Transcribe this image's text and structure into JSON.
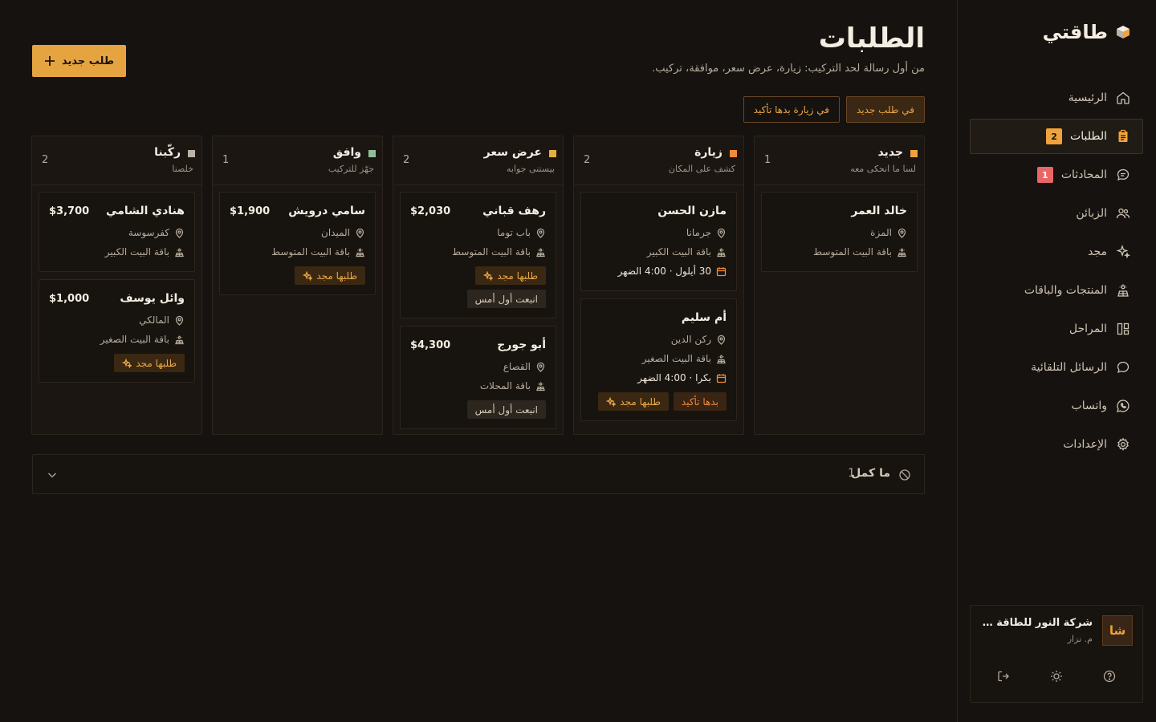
{
  "brand": {
    "name": "طاقتي",
    "icon": "cube-icon"
  },
  "nav": [
    {
      "label": "الرئيسية",
      "icon": "home-icon",
      "badge": ""
    },
    {
      "label": "الطلبات",
      "icon": "clipboard-icon",
      "badge": "2"
    },
    {
      "label": "المحادثات",
      "icon": "chat-icon",
      "badge": "1"
    },
    {
      "label": "الزبائن",
      "icon": "users-icon",
      "badge": ""
    },
    {
      "label": "مجد",
      "icon": "sparkles-icon",
      "badge": ""
    },
    {
      "label": "المنتجات والباقات",
      "icon": "solar-panel-icon",
      "badge": ""
    },
    {
      "label": "المراحل",
      "icon": "kanban-icon",
      "badge": ""
    },
    {
      "label": "الرسائل التلقائية",
      "icon": "message-icon",
      "badge": ""
    },
    {
      "label": "واتساب",
      "icon": "whatsapp-icon",
      "badge": ""
    },
    {
      "label": "الإعدادات",
      "icon": "gear-icon",
      "badge": ""
    }
  ],
  "account": {
    "avatar": "شا",
    "name": "شركة النور للطاقة الشمسية",
    "role": "م. نزار"
  },
  "header": {
    "title": "الطلبات",
    "subtitle": "من أول رسالة لحد التركيب: زيارة، عرض سعر، موافقة، تركيب.",
    "new_order_label": "طلب جديد"
  },
  "filters": [
    {
      "label": "في طلب جديد",
      "active": true
    },
    {
      "label": "في زيارة بدها تأكيد",
      "active": false
    }
  ],
  "columns": [
    {
      "title": "جديد",
      "desc": "لسا ما انحكى معه",
      "count": "1",
      "color": "#f0a23c",
      "cards": [
        {
          "name": "خالد العمر",
          "price": "",
          "location": "المزة",
          "package": "باقة البيت المتوسط",
          "date": "",
          "tags": []
        }
      ]
    },
    {
      "title": "زيارة",
      "desc": "كشف على المكان",
      "count": "2",
      "color": "#f08b3c",
      "cards": [
        {
          "name": "مازن الحسن",
          "price": "",
          "location": "جرمانا",
          "package": "باقة البيت الكبير",
          "date": "30 أيلول · 4:00 الضهر",
          "tags": []
        },
        {
          "name": "أم سليم",
          "price": "",
          "location": "ركن الدين",
          "package": "باقة البيت الصغير",
          "date": "بكرا · 4:00 الضهر",
          "tags": [
            {
              "label": "بدها تأكيد",
              "kind": "confirm"
            },
            {
              "label": "طلبها مجد",
              "kind": "majd"
            }
          ]
        }
      ]
    },
    {
      "title": "عرض سعر",
      "desc": "بيستنى جوابه",
      "count": "2",
      "color": "#e5b03f",
      "cards": [
        {
          "name": "رهف قباني",
          "price": "$2,030",
          "location": "باب توما",
          "package": "باقة البيت المتوسط",
          "date": "",
          "tags": [
            {
              "label": "طلبها مجد",
              "kind": "majd"
            },
            {
              "label": "انبعت أول أمس",
              "kind": "followup"
            }
          ]
        },
        {
          "name": "أبو جورج",
          "price": "$4,300",
          "location": "القصاع",
          "package": "باقة المحلات",
          "date": "",
          "tags": [
            {
              "label": "انبعت أول أمس",
              "kind": "followup"
            }
          ]
        }
      ]
    },
    {
      "title": "وافق",
      "desc": "جهّز للتركيب",
      "count": "1",
      "color": "#8fbf9a",
      "cards": [
        {
          "name": "سامي درويش",
          "price": "$1,900",
          "location": "الميدان",
          "package": "باقة البيت المتوسط",
          "date": "",
          "tags": [
            {
              "label": "طلبها مجد",
              "kind": "majd"
            }
          ]
        }
      ]
    },
    {
      "title": "ركّبنا",
      "desc": "خلصنا",
      "count": "2",
      "color": "#b9b2a6",
      "cards": [
        {
          "name": "هنادي الشامي",
          "price": "$3,700",
          "location": "كفرسوسة",
          "package": "باقة البيت الكبير",
          "date": "",
          "tags": []
        },
        {
          "name": "وائل يوسف",
          "price": "$1,000",
          "location": "المالكي",
          "package": "باقة البيت الصغير",
          "date": "",
          "tags": [
            {
              "label": "طلبها مجد",
              "kind": "majd"
            }
          ]
        }
      ]
    }
  ],
  "closed": {
    "label": "ما كمل",
    "count": "1"
  }
}
